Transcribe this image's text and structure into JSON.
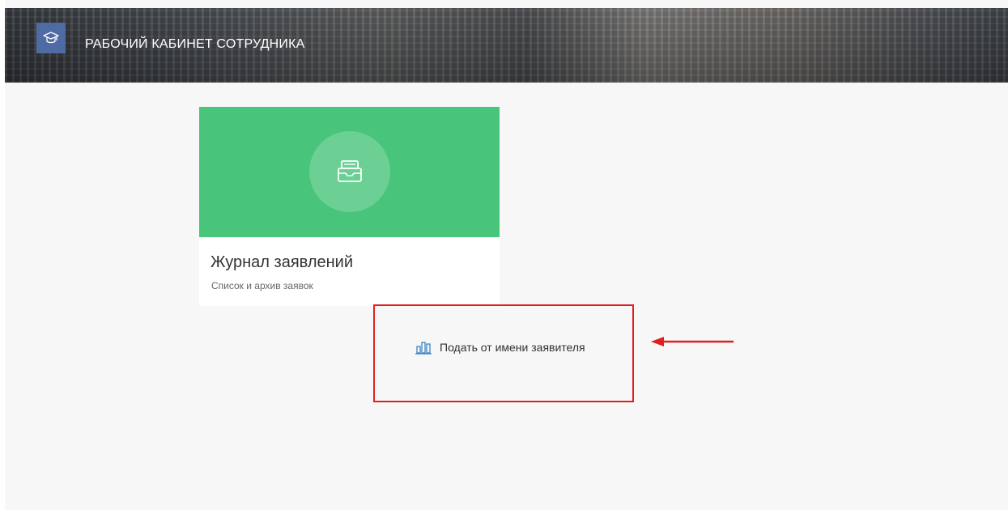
{
  "header": {
    "title": "РАБОЧИЙ КАБИНЕТ СОТРУДНИКА",
    "logo_icon": "graduation-cap-icon"
  },
  "card": {
    "title": "Журнал заявлений",
    "subtitle": "Список и архив заявок",
    "icon": "inbox-tray-icon",
    "accent_color": "#48c57b"
  },
  "apply_link": {
    "label": "Подать от имени заявителя",
    "icon": "bar-chart-icon",
    "icon_color": "#3a83c4"
  },
  "annotation": {
    "color": "#e02020"
  }
}
